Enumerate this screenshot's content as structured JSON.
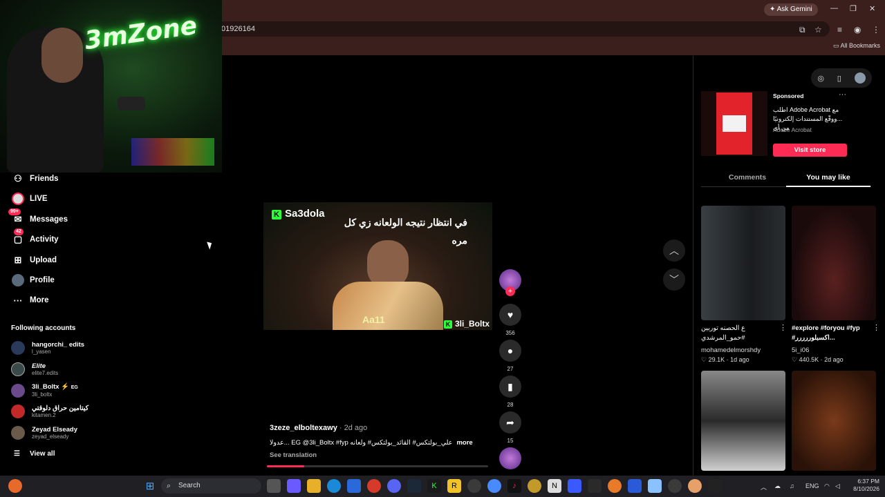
{
  "browser": {
    "url_fragment": "01926164",
    "ask_gemini": "Ask Gemini",
    "all_bookmarks": "All Bookmarks"
  },
  "webcam": {
    "logo_text": "3mZone"
  },
  "sidebar": {
    "nav": [
      {
        "label": "Friends",
        "icon": "friends-icon"
      },
      {
        "label": "LIVE",
        "icon": "live-icon"
      },
      {
        "label": "Messages",
        "icon": "messages-icon",
        "badge": "99+"
      },
      {
        "label": "Activity",
        "icon": "activity-icon",
        "badge": "42"
      },
      {
        "label": "Upload",
        "icon": "upload-icon"
      },
      {
        "label": "Profile",
        "icon": "profile-icon"
      },
      {
        "label": "More",
        "icon": "more-icon"
      }
    ],
    "following_title": "Following accounts",
    "accounts": [
      {
        "name": "hangorchi_ edits",
        "user": "l_yasen"
      },
      {
        "name": "Elite",
        "user": "elite7.edits"
      },
      {
        "name": "3li_Boltx",
        "user": "3li_boltx",
        "tag": "EG"
      },
      {
        "name": "كيتامين حراق دلوقتي",
        "user": "kitamen.2"
      },
      {
        "name": "Zeyad Elseady",
        "user": "zeyad_elseady"
      }
    ],
    "view_all": "View all"
  },
  "video": {
    "streamer": "Sa3dola",
    "caption": "في انتظار نتيجه الولعانه زي كل مره",
    "overlay_aa": "Aa11",
    "overlay_tag": "3li_Boltx",
    "progress": 0.17
  },
  "actions": {
    "likes": "356",
    "comments": "27",
    "saves": "28",
    "shares": "15"
  },
  "post": {
    "author": "3zeze_elboltexawy",
    "ago": "· 2d ago",
    "description": "عدولا... EG @3li_Boltx #fyp علي_بولتكس# القائد_بولتكس# ولعانه",
    "more": "more",
    "see_translation": "See translation"
  },
  "right_panel": {
    "sponsored": "Sponsored",
    "ad_title": "اطلب Adobe Acrobat مع ...ووقّع المستندات إلكترونيًا من أي",
    "ad_brand": "Adobe Acrobat",
    "visit_store": "Visit store",
    "tabs": [
      "Comments",
      "You may like"
    ],
    "videos": [
      {
        "caption": "ع الحصنه توربين #حمو_المرشدي",
        "author": "mohamedelmorshdy",
        "likes": "29.1K",
        "ago": "1d ago"
      },
      {
        "caption": "#explore #foryou #fyp #اكسبلوررررر...",
        "author": "5i_i06",
        "likes": "440.5K",
        "ago": "2d ago"
      }
    ]
  },
  "taskbar": {
    "search": "Search",
    "lang": "ENG",
    "time": "6:37 PM",
    "date": "8/10/2026"
  },
  "colors": {
    "accent": "#fe2c55",
    "chrome": "#3a1f1c"
  }
}
